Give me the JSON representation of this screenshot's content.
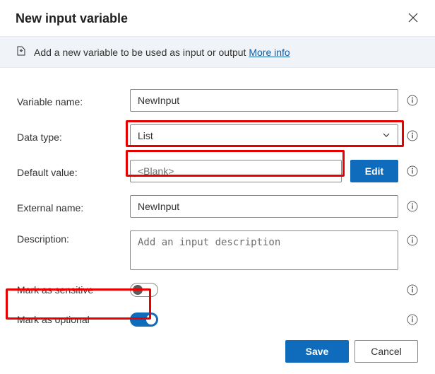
{
  "dialog": {
    "title": "New input variable"
  },
  "banner": {
    "text": "Add a new variable to be used as input or output ",
    "link": "More info"
  },
  "fields": {
    "variable_name": {
      "label": "Variable name:",
      "value": "NewInput"
    },
    "data_type": {
      "label": "Data type:",
      "value": "List"
    },
    "default_value": {
      "label": "Default value:",
      "value": "<Blank>",
      "edit_label": "Edit"
    },
    "external_name": {
      "label": "External name:",
      "value": "NewInput"
    },
    "description": {
      "label": "Description:",
      "placeholder": "Add an input description"
    },
    "mark_sensitive": {
      "label": "Mark as sensitive",
      "on": false
    },
    "mark_optional": {
      "label": "Mark as optional",
      "on": true
    }
  },
  "footer": {
    "save": "Save",
    "cancel": "Cancel"
  },
  "colors": {
    "accent": "#0f6cbd",
    "highlight": "#e60000",
    "banner_bg": "#f0f3f8"
  }
}
